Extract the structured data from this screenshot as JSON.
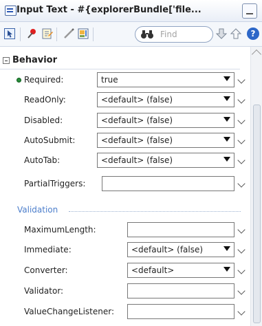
{
  "titlebar": {
    "title": "Input Text - #{explorerBundle['file..."
  },
  "toolbar": {
    "find_placeholder": "Find",
    "help_label": "?"
  },
  "section": {
    "title": "Behavior"
  },
  "fields": [
    {
      "label": "Required:",
      "value": "true"
    },
    {
      "label": "ReadOnly:",
      "value": "<default> (false)"
    },
    {
      "label": "Disabled:",
      "value": "<default> (false)"
    },
    {
      "label": "AutoSubmit:",
      "value": "<default> (false)"
    },
    {
      "label": "AutoTab:",
      "value": "<default> (false)"
    },
    {
      "label": "PartialTriggers:",
      "value": ""
    }
  ],
  "validation": {
    "title": "Validation",
    "fields": [
      {
        "label": "MaximumLength:",
        "value": ""
      },
      {
        "label": "Immediate:",
        "value": "<default> (false)"
      },
      {
        "label": "Converter:",
        "value": "<default>"
      },
      {
        "label": "Validator:",
        "value": ""
      },
      {
        "label": "ValueChangeListener:",
        "value": ""
      }
    ]
  },
  "icons": {
    "window": "component-icon",
    "select": "select-icon",
    "pin": "pin-icon",
    "edit": "edit-icon",
    "pencil": "pencil-icon",
    "layout": "layout-icon",
    "find": "binoculars-icon",
    "down": "down-arrow-icon",
    "up": "up-arrow-icon",
    "help": "help-icon"
  }
}
